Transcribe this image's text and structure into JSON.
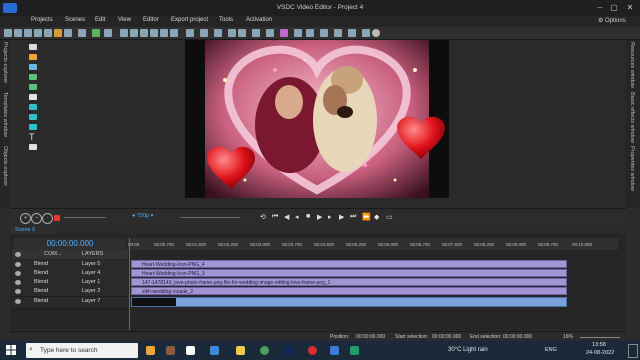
{
  "window": {
    "title": "VSDC Video Editor - Project 4"
  },
  "menu": {
    "items": [
      "Projects",
      "Scenes",
      "Edit",
      "View",
      "Editor",
      "Export project",
      "Tools",
      "Activation"
    ]
  },
  "options_label": "Options",
  "left_panels": [
    "Projects explorer",
    "Templates window",
    "Objects explorer"
  ],
  "right_panels": [
    "Resources window",
    "Basic effects window",
    "Properties window"
  ],
  "preview": {
    "zoom": "720p"
  },
  "scene_tab": "Scene 0",
  "timeline": {
    "current_time": "00:00:00.000",
    "header_com": "COM...",
    "header_layers": "LAYERS",
    "ruler_ticks": [
      "00:00",
      "00:00.750",
      "00:01.500",
      "00:02.250",
      "00:03.000",
      "00:03.750",
      "00:04.500",
      "00:05.250",
      "00:06.000",
      "00:06.750",
      "00:07.500",
      "00:08.250",
      "00:09.000",
      "00:09.750",
      "00:10.500"
    ],
    "tracks": [
      {
        "blend": "Blend",
        "layer": "Layer 5",
        "clip": "Heart-Wedding-Icon-PNG_4"
      },
      {
        "blend": "Blend",
        "layer": "Layer 4",
        "clip": "Heart-Wedding-Icon-PNG_3"
      },
      {
        "blend": "Blend",
        "layer": "Layer 1",
        "clip": "147-1478143_love-photo-frame-png-file-for-wedding-image-editing-love-frame-png_1"
      },
      {
        "blend": "Blend",
        "layer": "Layer 2",
        "clip": "sikh-wedding-couple_2"
      },
      {
        "blend": "Blend",
        "layer": "Layer 7",
        "clip": ""
      }
    ]
  },
  "status": {
    "position_label": "Position:",
    "position_value": "00:00:00.000",
    "start_label": "Start selection:",
    "start_value": "00:00:00.000",
    "end_label": "End selection:",
    "end_value": "00:00:00.000",
    "zoom": "16%"
  },
  "taskbar": {
    "search_placeholder": "Type here to search",
    "weather": "30°C  Light rain",
    "lang": "ENG",
    "time": "13:58",
    "date": "24-08-2022"
  },
  "colors": {
    "accent": "#4fb0ff",
    "clip": "#a394d3",
    "video_clip": "#7aa0d8",
    "playhead": "#ee3333"
  }
}
